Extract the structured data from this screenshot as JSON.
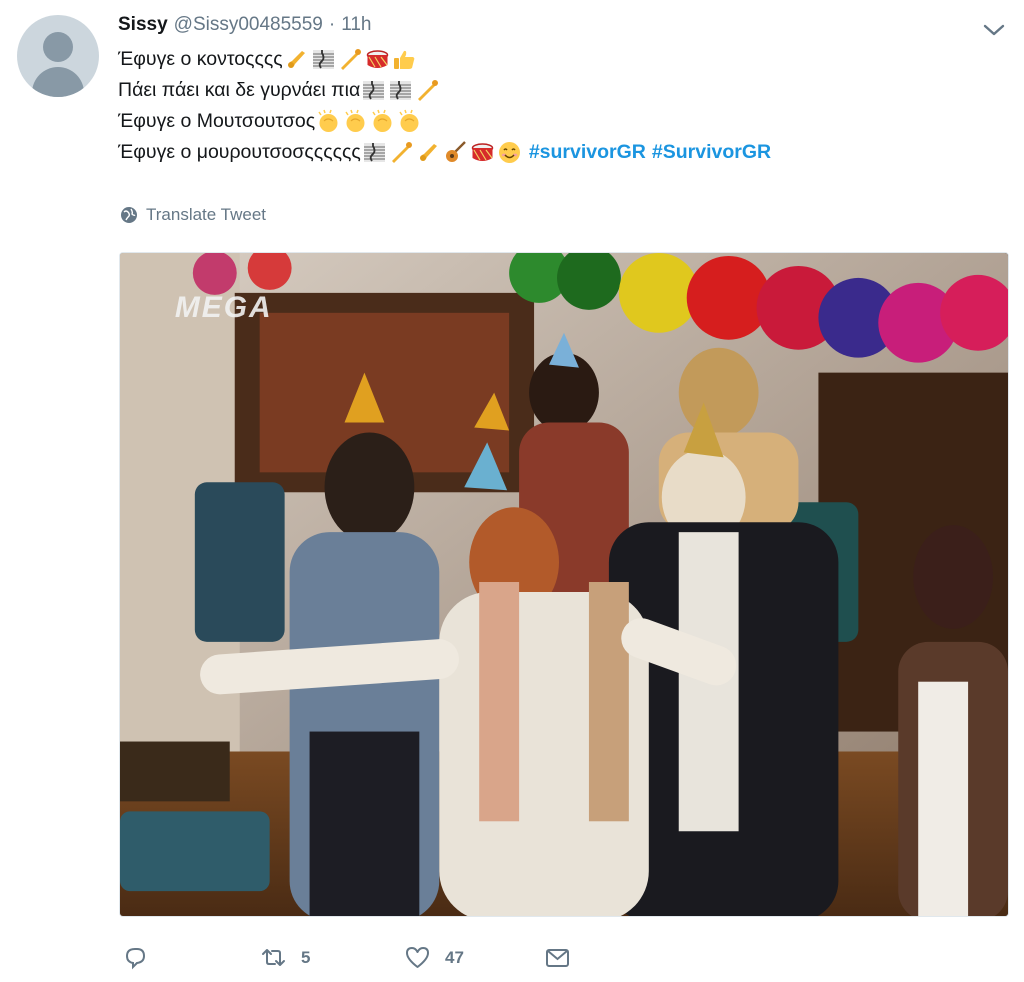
{
  "tweet": {
    "display_name": "Sissy",
    "handle": "@Sissy00485559",
    "separator": "·",
    "timestamp": "11h",
    "lines": [
      {
        "text": "Έφυγε ο κοντοςςςς",
        "emojis": [
          "saxophone",
          "musical-score",
          "trumpet",
          "drum",
          "thumbs-up"
        ]
      },
      {
        "text": "Πάει πάει και δε γυρνάει πια",
        "emojis": [
          "musical-score",
          "musical-score",
          "trumpet"
        ]
      },
      {
        "text": "Έφυγε ο Μουτσουτσος",
        "emojis": [
          "clapping-hands",
          "clapping-hands",
          "clapping-hands",
          "clapping-hands"
        ]
      },
      {
        "text": "Έφυγε ο μουρουτσοσςςςςςς",
        "emojis": [
          "musical-score",
          "trumpet",
          "saxophone",
          "guitar",
          "drum",
          "smiling-face"
        ]
      }
    ],
    "hashtags": [
      "#survivorGR",
      "#SurvivorGR"
    ],
    "translate_label": "Translate Tweet",
    "media": {
      "watermark": "MEGA",
      "description_icon": "video-frame"
    },
    "actions": {
      "reply_count": "",
      "retweet_count": "5",
      "like_count": "47"
    }
  },
  "colors": {
    "link": "#1b95e0",
    "secondary_text": "#657786",
    "primary_text": "#14171a"
  }
}
